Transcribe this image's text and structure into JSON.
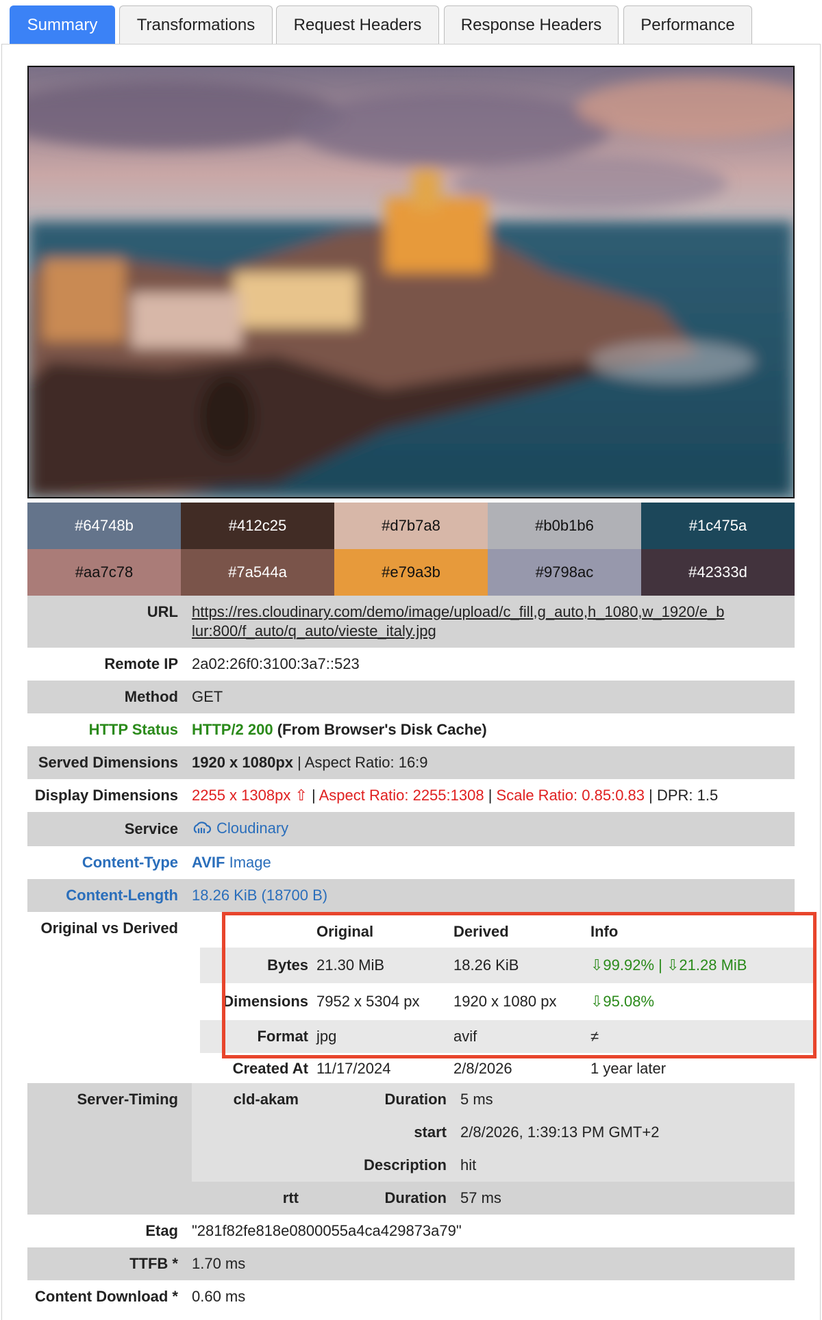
{
  "tabs": [
    {
      "label": "Summary",
      "active": true
    },
    {
      "label": "Transformations",
      "active": false
    },
    {
      "label": "Request Headers",
      "active": false
    },
    {
      "label": "Response Headers",
      "active": false
    },
    {
      "label": "Performance",
      "active": false
    }
  ],
  "palette": [
    {
      "hex": "#64748b",
      "text": "#ffffff"
    },
    {
      "hex": "#412c25",
      "text": "#ffffff"
    },
    {
      "hex": "#d7b7a8",
      "text": "#111111"
    },
    {
      "hex": "#b0b1b6",
      "text": "#111111"
    },
    {
      "hex": "#1c475a",
      "text": "#ffffff"
    },
    {
      "hex": "#aa7c78",
      "text": "#111111"
    },
    {
      "hex": "#7a544a",
      "text": "#ffffff"
    },
    {
      "hex": "#e79a3b",
      "text": "#111111"
    },
    {
      "hex": "#9798ac",
      "text": "#111111"
    },
    {
      "hex": "#42333d",
      "text": "#ffffff"
    }
  ],
  "info": {
    "url_label": "URL",
    "url": "https://res.cloudinary.com/demo/image/upload/c_fill,g_auto,h_1080,w_1920/e_blur:800/f_auto/q_auto/vieste_italy.jpg",
    "url_line1": "https://res.cloudinary.com/demo/image/upload/c_fill,g_auto,h_1080,w_1920/e_b",
    "url_line2": "lur:800/f_auto/q_auto/vieste_italy.jpg",
    "remote_ip_label": "Remote IP",
    "remote_ip": "2a02:26f0:3100:3a7::523",
    "method_label": "Method",
    "method": "GET",
    "http_status_label": "HTTP Status",
    "http_status": "HTTP/2 200",
    "http_status_note": " (From Browser's Disk Cache)",
    "served_label": "Served Dimensions",
    "served_dims": "1920 x 1080px",
    "served_aspect": " | Aspect Ratio: 16:9",
    "display_label": "Display Dimensions",
    "display_dims": "2255 x 1308px ⇧",
    "sep": " | ",
    "display_aspect": "Aspect Ratio: 2255:1308",
    "display_scale": "Scale Ratio: 0.85:0.83",
    "display_dpr": "DPR: 1.5",
    "service_label": "Service",
    "service": "Cloudinary",
    "content_type_label": "Content-Type",
    "content_type_format": "AVIF",
    "content_type_kind": " Image",
    "content_length_label": "Content-Length",
    "content_length": "18.26 KiB (18700 B)",
    "ovd_label": "Original vs Derived",
    "etag_label": "Etag",
    "etag": "\"281f82fe818e0800055a4ca429873a79\"",
    "ttfb_label": "TTFB *",
    "ttfb": "1.70 ms",
    "download_label": "Content Download *",
    "download": "0.60 ms"
  },
  "comparison": {
    "headers": [
      "",
      "Original",
      "Derived",
      "Info"
    ],
    "rows": [
      {
        "label": "Bytes",
        "original": "21.30 MiB",
        "derived": "18.26 KiB",
        "info": "⇩99.92% | ⇩21.28 MiB"
      },
      {
        "label": "Dimensions",
        "original": "7952 x 5304 px",
        "derived": "1920 x 1080 px",
        "info": "⇩95.08%"
      },
      {
        "label": "Format",
        "original": "jpg",
        "derived": "avif",
        "info": "≠"
      },
      {
        "label": "Created At",
        "original": "11/17/2024",
        "derived": "2/8/2026",
        "info": "1 year later"
      }
    ]
  },
  "server_timing": {
    "label": "Server-Timing",
    "entries": [
      {
        "name": "cld-akam",
        "key": "Duration",
        "value": "5 ms"
      },
      {
        "name": "",
        "key": "start",
        "value": "2/8/2026, 1:39:13 PM GMT+2"
      },
      {
        "name": "",
        "key": "Description",
        "value": "hit"
      },
      {
        "name": "rtt",
        "key": "Duration",
        "value": "57 ms"
      }
    ]
  },
  "colors": {
    "accent": "#3b82f6",
    "highlight": "#e8452c",
    "ok": "#2a8a1a",
    "warn": "#e02020",
    "link": "#2a6ebb"
  }
}
